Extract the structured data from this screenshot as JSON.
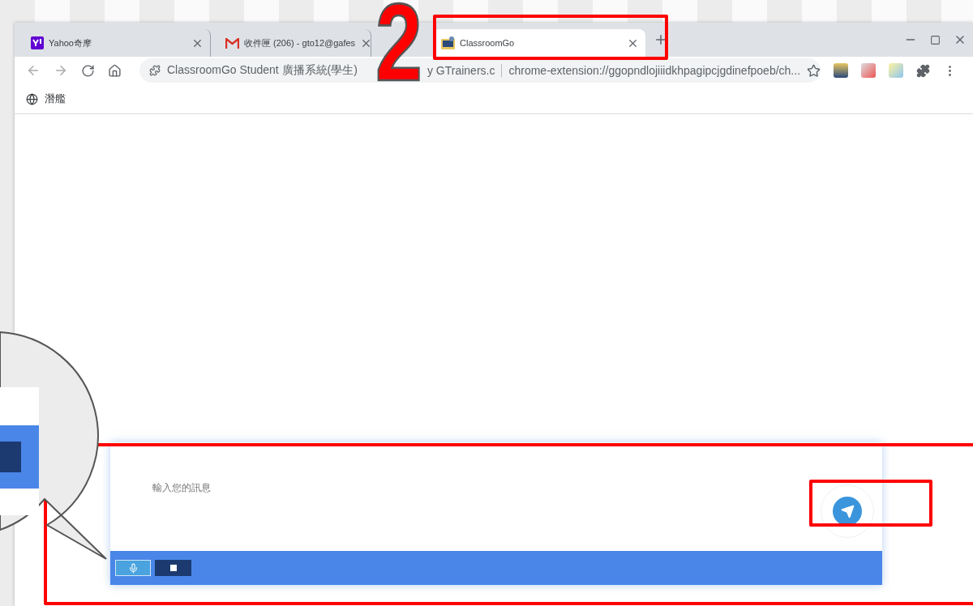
{
  "annotation": {
    "step": "2"
  },
  "tabs": [
    {
      "kind": "yahoo",
      "title": "Yahoo奇摩",
      "selected": false
    },
    {
      "kind": "mail",
      "title": "收件匣 (206) - gto12@gafes",
      "selected": false
    },
    {
      "kind": "classroom",
      "title": "ClassroomGo",
      "selected": true
    }
  ],
  "address_bar": {
    "site": "ClassroomGo Student 廣播系統(學生)",
    "site_rest": "y GTrainers.c",
    "url": "chrome-extension://ggopndlojiiidkhpagipcjgdinefpoeb/ch..."
  },
  "bookmarks": [
    {
      "title": "潛艦"
    }
  ],
  "chat": {
    "placeholder": "輸入您的訊息"
  }
}
